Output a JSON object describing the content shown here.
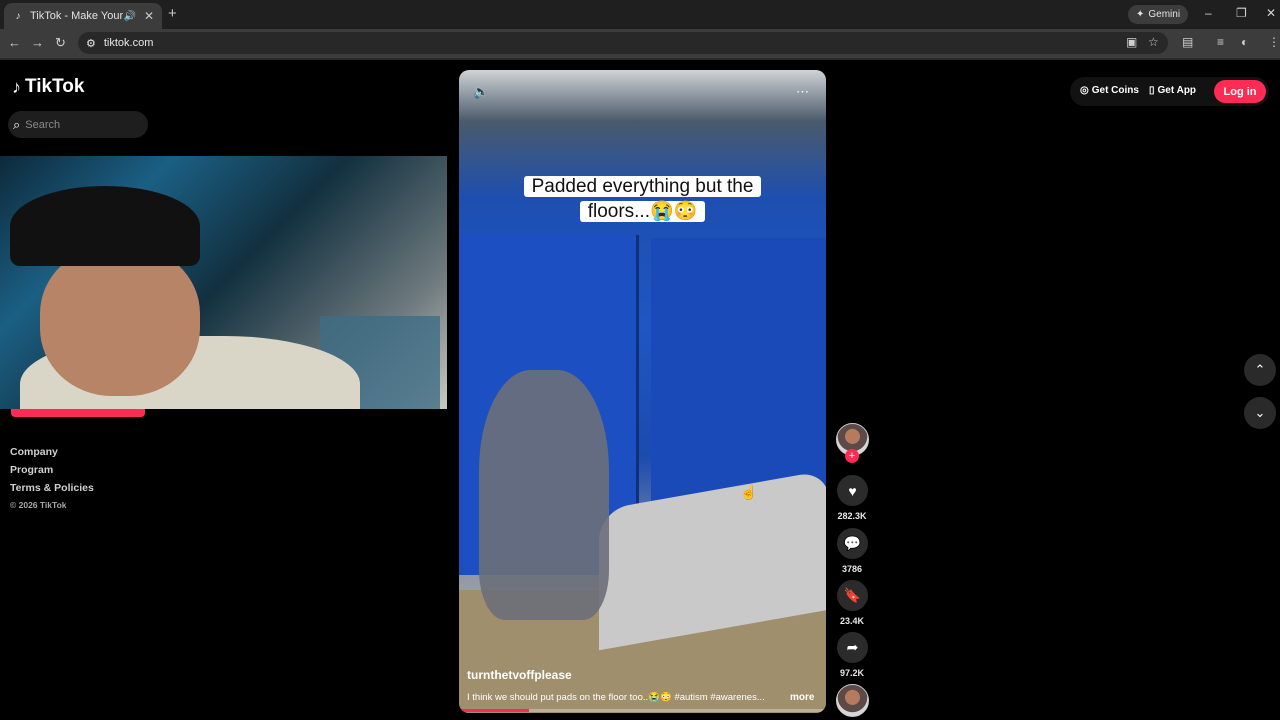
{
  "browser": {
    "tab_title": "TikTok - Make Your Day",
    "url": "tiktok.com",
    "gemini_label": "Gemini",
    "icons": {
      "tab_favicon": "tiktok-icon",
      "audio": "speaker-icon",
      "close": "close-icon",
      "new_tab": "plus-icon"
    }
  },
  "sidebar": {
    "logo_text": "TikTok",
    "search_placeholder": "Search",
    "footer": {
      "company": "Company",
      "program": "Program",
      "terms": "Terms & Policies",
      "copyright": "© 2026 TikTok"
    }
  },
  "video": {
    "caption_text": "Padded everything but the floors...😭😳",
    "author": "turnthetvoffplease",
    "description": "I think we should put pads on the floor too..😭😳 #autism #awarenes...",
    "more_label": "more",
    "progress": 0.19
  },
  "actions": {
    "likes": "282.3K",
    "comments": "3786",
    "saves": "23.4K",
    "shares": "97.2K"
  },
  "header": {
    "get_coins": "Get Coins",
    "get_app": "Get App",
    "login": "Log in"
  },
  "colors": {
    "accent": "#fe2c55",
    "background": "#000000"
  }
}
